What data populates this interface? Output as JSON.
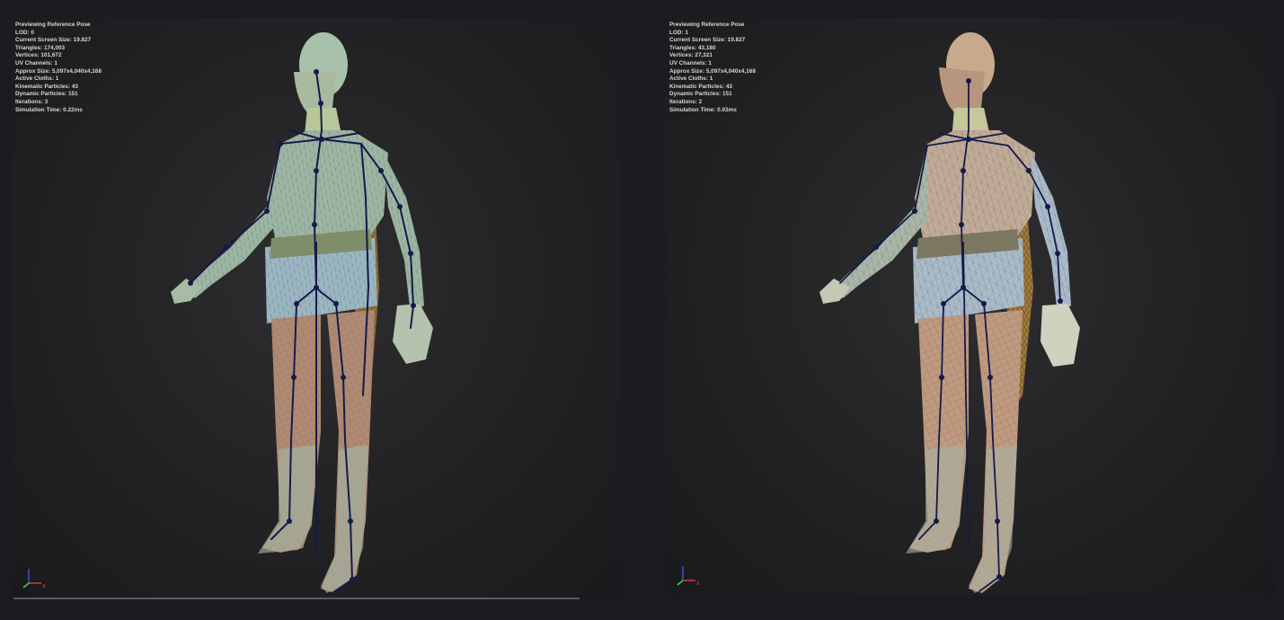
{
  "viewports": [
    {
      "id": "left",
      "stats": [
        "Previewing Reference Pose",
        "LOD: 0",
        "Current Screen Size: 19.827",
        "Triangles: 174,003",
        "Vertices: 101,672",
        "UV Channels: 1",
        "Approx Size: 5,097x4,040x4,168",
        "Active Cloths: 1",
        "Kinematic Particles: 43",
        "Dynamic Particles: 151",
        "Iterations: 3",
        "Simulation Time: 0.22ms"
      ],
      "axis_label": "x"
    },
    {
      "id": "right",
      "stats": [
        "Previewing Reference Pose",
        "LOD: 1",
        "Current Screen Size: 19.827",
        "Triangles: 43,180",
        "Vertices: 27,321",
        "UV Channels: 1",
        "Approx Size: 5,097x4,040x4,168",
        "Active Cloths: 1",
        "Kinematic Particles: 43",
        "Dynamic Particles: 151",
        "Iterations: 2",
        "Simulation Time: 0.03ms"
      ],
      "axis_label": "x"
    }
  ],
  "colors": {
    "background": "#1b1c21",
    "viewport": "#262628",
    "stats_text": "#d6d6d6",
    "mesh_left": "#9fb7a4",
    "mesh_right": "#c9b39a",
    "skeleton": "#141a4a",
    "cape": "#9a7a3e"
  },
  "icons": {
    "axis_gizmo": "axis-gizmo-icon"
  }
}
